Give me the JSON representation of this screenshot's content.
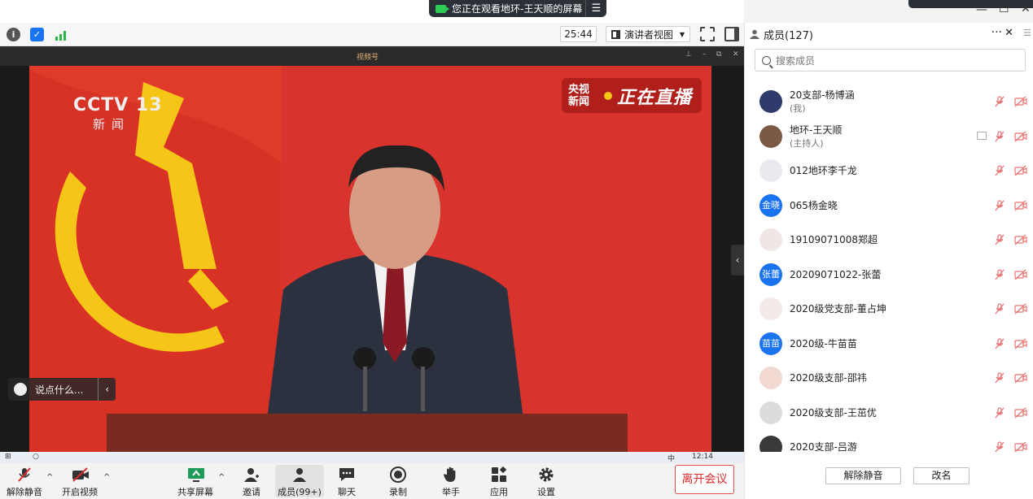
{
  "share_banner": {
    "text": "您正在观看地环-王天顺的屏幕",
    "menu_icon": "menu-icon"
  },
  "toolbar": {
    "timer": "25:44",
    "view_mode": "演讲者视图"
  },
  "video": {
    "brand_text": "视频号",
    "channel_logo": "CCTV",
    "channel_number": "13",
    "channel_sub": "新闻",
    "live_label_small": "央视新闻",
    "live_label_big": "正在直播",
    "chat_placeholder": "说点什么...",
    "taskbar_time": "12:14",
    "taskbar_ime": "中"
  },
  "controls": {
    "unmute": "解除静音",
    "start_video": "开启视频",
    "share_screen": "共享屏幕",
    "invite": "邀请",
    "members": "成员(99+)",
    "chat": "聊天",
    "record": "录制",
    "raise_hand": "举手",
    "apps": "应用",
    "settings": "设置",
    "leave": "离开会议"
  },
  "panel": {
    "title": "成员(127)",
    "search_placeholder": "搜索成员",
    "members": [
      {
        "name": "20支部-杨博涵",
        "role": "(我)",
        "avatar_text": "",
        "avatar_color": "#2f3b6b"
      },
      {
        "name": "地环-王天顺",
        "role": "(主持人)",
        "avatar_text": "",
        "avatar_color": "#7a5a45"
      },
      {
        "name": "012地环李千龙",
        "role": "",
        "avatar_text": "",
        "avatar_color": "#e9e9ef"
      },
      {
        "name": "065杨金晓",
        "role": "",
        "avatar_text": "金晓",
        "avatar_color": "#1a73f0"
      },
      {
        "name": "19109071008郑超",
        "role": "",
        "avatar_text": "",
        "avatar_color": "#f0e6e6"
      },
      {
        "name": "20209071022-张蕾",
        "role": "",
        "avatar_text": "张蕾",
        "avatar_color": "#1a73f0"
      },
      {
        "name": "2020级党支部-董占坤",
        "role": "",
        "avatar_text": "",
        "avatar_color": "#f3e9e9"
      },
      {
        "name": "2020级-牛苗苗",
        "role": "",
        "avatar_text": "苗苗",
        "avatar_color": "#1a73f0"
      },
      {
        "name": "2020级支部-邵祎",
        "role": "",
        "avatar_text": "",
        "avatar_color": "#f1d9d2"
      },
      {
        "name": "2020级支部-王茁优",
        "role": "",
        "avatar_text": "",
        "avatar_color": "#dcdcdc"
      },
      {
        "name": "2020支部-吕游",
        "role": "",
        "avatar_text": "",
        "avatar_color": "#3a3a3a"
      }
    ],
    "unmute_all": "解除静音",
    "rename": "改名"
  },
  "colors": {
    "accent": "#1a73f0",
    "leave": "#e02a2a",
    "mic_off": "#e57373"
  }
}
